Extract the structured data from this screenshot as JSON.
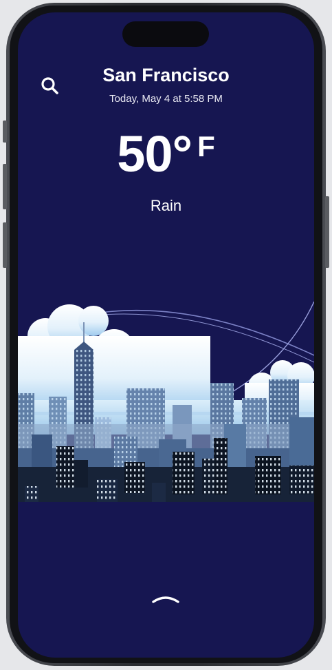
{
  "header": {
    "city": "San Francisco",
    "datetime": "Today, May 4 at 5:58 PM"
  },
  "weather": {
    "temperature": "50°",
    "unit": "F",
    "condition": "Rain"
  },
  "icons": {
    "search": "search-icon",
    "expand": "chevron-up-icon"
  },
  "colors": {
    "background": "#161651",
    "text": "#ffffff"
  }
}
